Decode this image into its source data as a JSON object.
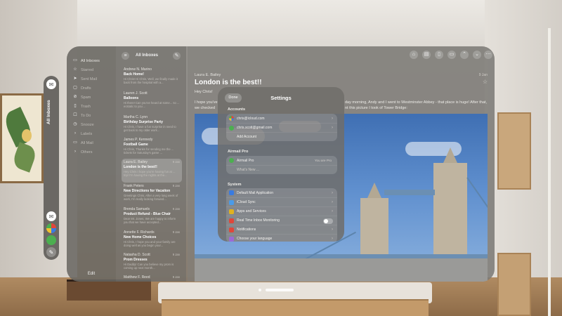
{
  "ornament": {
    "label": "All Inboxes"
  },
  "sidebar": {
    "items": [
      {
        "label": "All Inboxes",
        "icon": "inbox-icon"
      },
      {
        "label": "Starred",
        "icon": "star-icon"
      },
      {
        "label": "Sent Mail",
        "icon": "send-icon"
      },
      {
        "label": "Drafts",
        "icon": "draft-icon"
      },
      {
        "label": "Spam",
        "icon": "spam-icon"
      },
      {
        "label": "Trash",
        "icon": "trash-icon"
      },
      {
        "label": "To Do",
        "icon": "todo-icon"
      },
      {
        "label": "Snooze",
        "icon": "clock-icon"
      },
      {
        "label": "Labels",
        "icon": "chevron-right-icon"
      },
      {
        "label": "All Mail",
        "icon": "mail-icon"
      },
      {
        "label": "Others",
        "icon": "chevron-right-icon"
      }
    ],
    "edit_label": "Edit"
  },
  "list": {
    "title": "All Inboxes",
    "messages": [
      {
        "from": "Andrew N. Marino",
        "date": "",
        "subject": "Back Home!",
        "preview": "Hi Chris! Hi Chris, Well, we finally made it back from the hospital with a..."
      },
      {
        "from": "Lauren J. Scott",
        "date": "",
        "subject": "Balloons",
        "preview": "Hi there! Can you've heard at some... so ... ecstatic to you ..."
      },
      {
        "from": "Martha C. Lynn",
        "date": "",
        "subject": "Birthday Surprise Party",
        "preview": "Hi Chris, I have a fun surprise in need to get back to my older work..."
      },
      {
        "from": "James P. Kennedy",
        "date": "",
        "subject": "Football Game",
        "preview": "Hi Chris, Thanks for sending me the ... tickets for Saturday's game ..."
      },
      {
        "from": "Laura E. Bailey",
        "date": "9 Jan",
        "subject": "London is the best!!",
        "preview": "Hey Chris I hope you're having fun at ... trip! I'm having the nights at the..."
      },
      {
        "from": "Frank Peters",
        "date": "9 Jan",
        "subject": "New Directions for Vacation",
        "preview": "Greetings Chris, After a very long week of work, I'm really looking forward..."
      },
      {
        "from": "Brenda Samuels",
        "date": "9 Jan",
        "subject": "Product Refund - Blue Chair",
        "preview": "Dear Mr. Jones, We are happy to inform you that we have accepted..."
      },
      {
        "from": "Annette F. Richards",
        "date": "9 Jan",
        "subject": "New Home Choices",
        "preview": "Hi Chris, I hope you and your family are doing well as you begin your..."
      },
      {
        "from": "Natasha D. Scott",
        "date": "9 Jan",
        "subject": "Prom Dresses",
        "preview": "Hi Daddy! Can you believe my prom is coming up next month..."
      },
      {
        "from": "Matthew F. Reed",
        "date": "9 Jan",
        "subject": "",
        "preview": ""
      }
    ]
  },
  "reader": {
    "from": "Laura E. Bailey",
    "date": "9 Jan",
    "subject": "London is the best!!",
    "greeting": "Hey Chris!",
    "body_left_1": "I hope you've",
    "body_left_2": "we checked",
    "body_right_1": "day morning, Andy and I went to Westminster Abbey - that place is huge! After that,",
    "body_right_2": "nt this picture I took of Tower Bridge:"
  },
  "settings": {
    "title": "Settings",
    "done_label": "Done",
    "accounts_header": "Accounts",
    "accounts": [
      {
        "label": "chris@icloud.com",
        "color": "#e2463b"
      },
      {
        "label": "chris.scott@gmail.com",
        "color": "#4caf50"
      }
    ],
    "add_account_label": "Add Account",
    "airmail_pro_header": "Airmail Pro",
    "airmail_pro_label": "Airmail Pro",
    "airmail_pro_value": "You are Pro",
    "whats_new_label": "What's New ...",
    "system_header": "System",
    "system_items": [
      {
        "label": "Default Mail Application",
        "color": "#3a7be0"
      },
      {
        "label": "iCloud Sync",
        "color": "#4a9be8"
      },
      {
        "label": "Apps and Services",
        "color": "#e0b21f"
      },
      {
        "label": "Real Time Inbox Monitoring",
        "color": "#e0473a"
      },
      {
        "label": "Notifications",
        "color": "#e0473a"
      },
      {
        "label": "Choose your language",
        "color": "#9b6ad6"
      }
    ]
  },
  "toolbar": {
    "icons": [
      "archive-icon",
      "move-icon",
      "trash-icon",
      "folder-icon",
      "chevron-up-icon",
      "chevron-down-icon",
      "more-icon"
    ]
  }
}
